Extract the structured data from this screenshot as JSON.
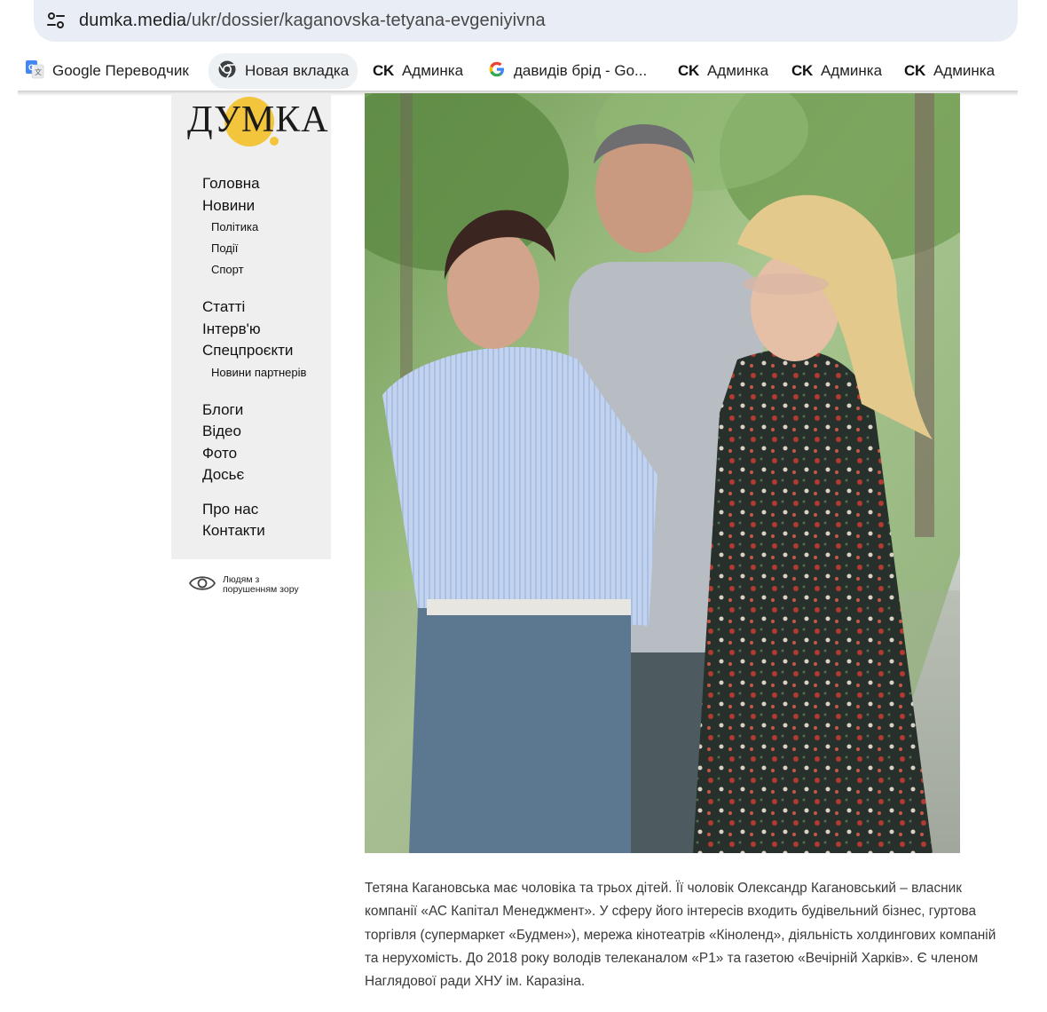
{
  "browser": {
    "url_host": "dumka.media",
    "url_path": "/ukr/dossier/kaganovska-tetyana-evgeniyivna",
    "site_info_icon": "tune-icon",
    "bookmarks": [
      {
        "label": "Google Переводчик",
        "icon": "google-translate-icon"
      },
      {
        "label": "Новая вкладка",
        "icon": "chrome-icon"
      },
      {
        "label": "Админка",
        "icon": "ck-logo",
        "logo_text": "CK"
      },
      {
        "label": "давидів брід - Go...",
        "icon": "google-g-icon"
      },
      {
        "label": "Админка",
        "icon": "ck-logo",
        "logo_text": "CK"
      },
      {
        "label": "Админка",
        "icon": "ck-logo",
        "logo_text": "CK"
      },
      {
        "label": "Админка",
        "icon": "ck-logo",
        "logo_text": "CK"
      }
    ]
  },
  "site": {
    "logo_text": "ДУМКА",
    "brand_color": "#f2c53d",
    "nav": {
      "home": "Головна",
      "news": "Новини",
      "news_sub": [
        "Політика",
        "Події",
        "Спорт"
      ],
      "articles": "Статті",
      "interviews": "Інтерв'ю",
      "special": "Спецпроєкти",
      "special_sub": [
        "Новини партнерів"
      ],
      "blogs": "Блоги",
      "video": "Відео",
      "photo": "Фото",
      "dossier": "Досьє",
      "about": "Про нас",
      "contacts": "Контакти"
    },
    "accessibility_label": "Людям з порушенням зору",
    "accessibility_icon": "eye-icon"
  },
  "article": {
    "caption": "Тетяна Кагановська має чоловіка та трьох дітей. Її чоловік Олександр Кагановський – власник компанії «АС Капітал Менеджмент». У сферу його інтересів входить будівельний бізнес, гуртова торгівля (супермаркет «Будмен»), мережа кінотеатрів «Кіноленд», діяльність холдингових компаній та нерухомість. До 2018 року володів телеканалом «Р1» та газетою «Вечірній Харків». Є членом Наглядової ради ХНУ ім. Каразіна."
  }
}
